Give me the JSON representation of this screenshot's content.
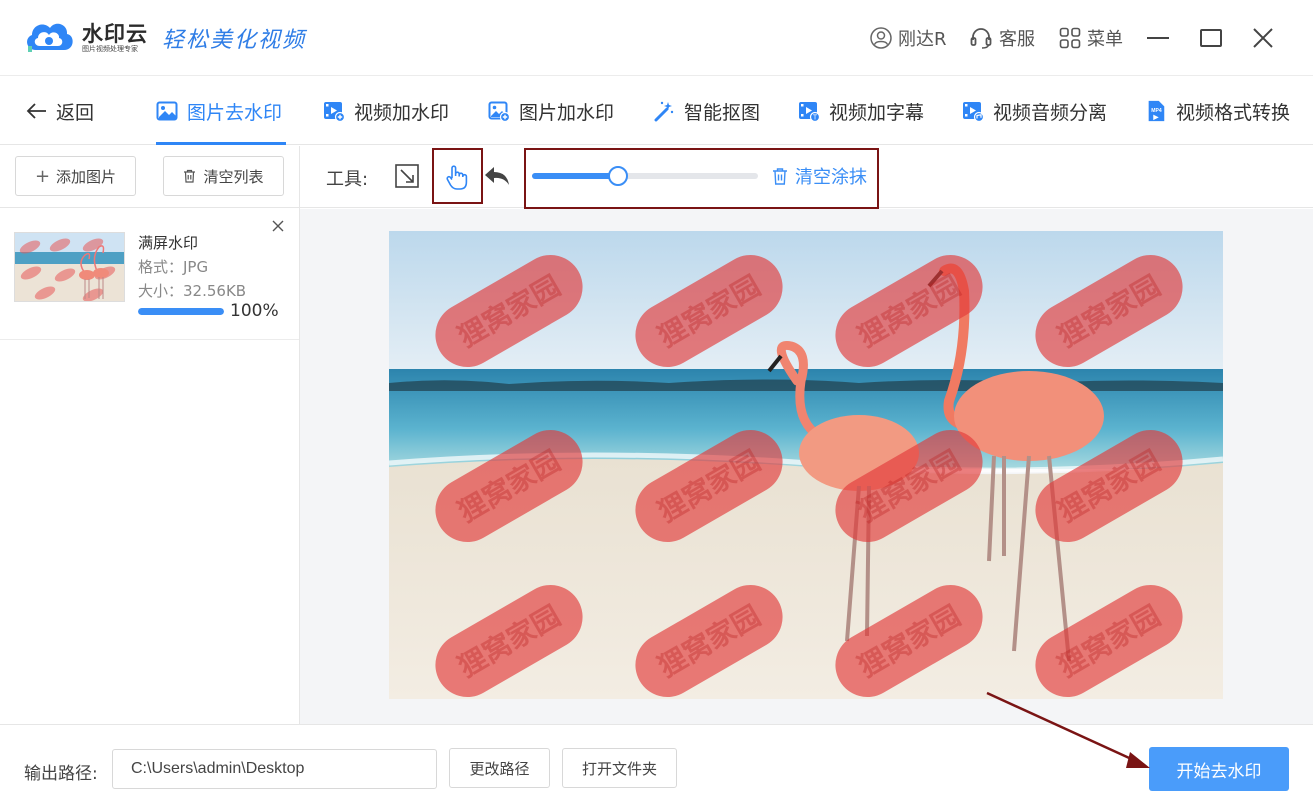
{
  "app": {
    "brand": "水印云",
    "brand_sub": "图片视频处理专家",
    "slogan": "轻松美化视频",
    "brand_color": "#2f86f6"
  },
  "titlebar": {
    "user": "刚达R",
    "service": "客服",
    "menu": "菜单"
  },
  "nav": {
    "back": "返回",
    "tabs": [
      {
        "label": "图片去水印",
        "icon": "image-icon",
        "active": true
      },
      {
        "label": "视频加水印",
        "icon": "video-icon",
        "active": false
      },
      {
        "label": "图片加水印",
        "icon": "image-add-icon",
        "active": false
      },
      {
        "label": "智能抠图",
        "icon": "magic-wand-icon",
        "active": false
      },
      {
        "label": "视频加字幕",
        "icon": "video-subtitle-icon",
        "active": false
      },
      {
        "label": "视频音频分离",
        "icon": "audio-separate-icon",
        "active": false
      },
      {
        "label": "视频格式转换",
        "icon": "mp4-icon",
        "active": false
      }
    ],
    "mp4_badge": "MP4"
  },
  "sidebar": {
    "add_button": "添加图片",
    "clear_button": "清空列表",
    "files": [
      {
        "name": "满屏水印",
        "format": "格式：JPG",
        "size": "大小：32.56KB",
        "progress": 1.0,
        "progress_text": "100%"
      }
    ]
  },
  "toolbar": {
    "label": "工具:",
    "brush_size": 0.38,
    "clear_label": "清空涂抹"
  },
  "canvas": {
    "watermark_text": "狸窝家园"
  },
  "bottom": {
    "output_label": "输出路径:",
    "output_path": "C:\\Users\\admin\\Desktop",
    "change_path": "更改路径",
    "open_folder": "打开文件夹",
    "start": "开始去水印"
  }
}
